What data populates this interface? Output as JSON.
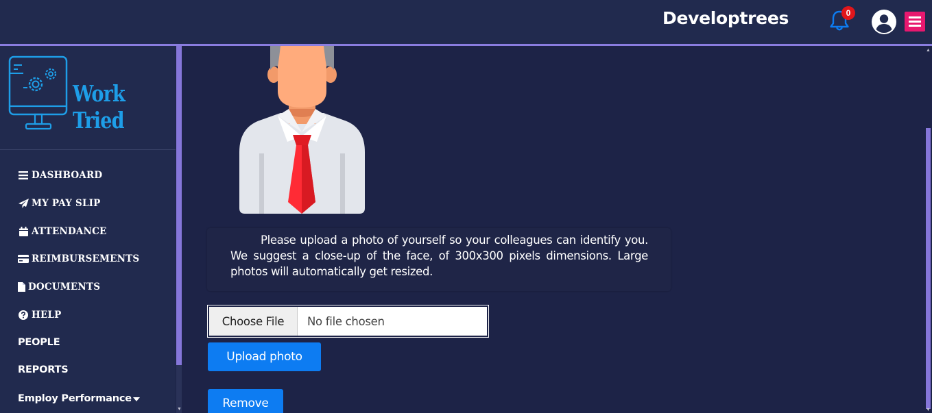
{
  "header": {
    "brand": "Developtrees",
    "notification_count": "0",
    "icons": {
      "bell": "bell-icon",
      "user": "user-circle-icon",
      "menu": "hamburger-menu-icon"
    },
    "colors": {
      "background": "#212a4e",
      "bell": "#0d7cf2",
      "badge": "#e0161b",
      "menu_button": "#e8186f",
      "accent_line": "#8a7de0"
    }
  },
  "sidebar": {
    "logo_text": "Work Tried",
    "logo_icon": "monitor-gears-icon",
    "items": [
      {
        "label": "DASHBOARD",
        "icon": "bars-icon"
      },
      {
        "label": "MY PAY SLIP",
        "icon": "paper-plane-icon"
      },
      {
        "label": "ATTENDANCE",
        "icon": "calendar-icon"
      },
      {
        "label": "REIMBURSEMENTS",
        "icon": "credit-card-icon"
      },
      {
        "label": "DOCUMENTS",
        "icon": "file-icon"
      },
      {
        "label": "HELP",
        "icon": "question-circle-icon"
      },
      {
        "label": "PEOPLE",
        "icon": ""
      },
      {
        "label": "REPORTS",
        "icon": ""
      },
      {
        "label": "Employ Performance",
        "icon": "caret-down-icon"
      }
    ]
  },
  "main": {
    "profile_image": "default-male-avatar",
    "info_text": "Please upload a photo of yourself so your colleagues can identify you. We suggest a close-up of the face, of 300x300 pixels dimensions. Large photos will automatically get resized.",
    "file_input": {
      "button_label": "Choose File",
      "status": "No file chosen"
    },
    "upload_button": "Upload photo",
    "remove_button": "Remove",
    "button_color": "#0d7cf2"
  }
}
